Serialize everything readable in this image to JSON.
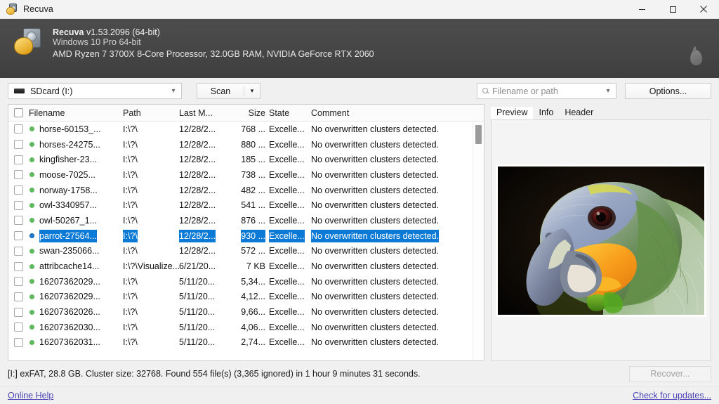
{
  "window": {
    "title": "Recuva",
    "app_icon": "recuva-icon",
    "controls": {
      "minimize": "minimize-icon",
      "maximize": "maximize-icon",
      "close": "close-icon"
    }
  },
  "info_header": {
    "app_name": "Recuva",
    "version": "v1.53.2096 (64-bit)",
    "os": "Windows 10 Pro 64-bit",
    "hardware": "AMD Ryzen 7 3700X 8-Core Processor, 32.0GB RAM, NVIDIA GeForce RTX 2060",
    "droplet_icon": "droplet-icon"
  },
  "toolbar": {
    "drive": {
      "icon": "drive-icon",
      "value": "SDcard (I:)",
      "chevron": "chevron-down-icon"
    },
    "scan_label": "Scan",
    "scan_dropdown": "chevron-down-icon",
    "filter": {
      "icon": "search-icon",
      "placeholder": "Filename or path",
      "value": "",
      "chevron": "chevron-down-icon"
    },
    "options_label": "Options..."
  },
  "list": {
    "columns": [
      "Filename",
      "Path",
      "Last M...",
      "Size",
      "State",
      "Comment"
    ],
    "select_all_checkbox": false,
    "rows": [
      {
        "checked": false,
        "state_dot": "green",
        "filename": "horse-60153_...",
        "path": "I:\\?\\",
        "modified": "12/28/2...",
        "size": "768 ...",
        "state": "Excelle...",
        "comment": "No overwritten clusters detected.",
        "selected": false
      },
      {
        "checked": false,
        "state_dot": "green",
        "filename": "horses-24275...",
        "path": "I:\\?\\",
        "modified": "12/28/2...",
        "size": "880 ...",
        "state": "Excelle...",
        "comment": "No overwritten clusters detected.",
        "selected": false
      },
      {
        "checked": false,
        "state_dot": "green",
        "filename": "kingfisher-23...",
        "path": "I:\\?\\",
        "modified": "12/28/2...",
        "size": "185 ...",
        "state": "Excelle...",
        "comment": "No overwritten clusters detected.",
        "selected": false
      },
      {
        "checked": false,
        "state_dot": "green",
        "filename": "moose-7025...",
        "path": "I:\\?\\",
        "modified": "12/28/2...",
        "size": "738 ...",
        "state": "Excelle...",
        "comment": "No overwritten clusters detected.",
        "selected": false
      },
      {
        "checked": false,
        "state_dot": "green",
        "filename": "norway-1758...",
        "path": "I:\\?\\",
        "modified": "12/28/2...",
        "size": "482 ...",
        "state": "Excelle...",
        "comment": "No overwritten clusters detected.",
        "selected": false
      },
      {
        "checked": false,
        "state_dot": "green",
        "filename": "owl-3340957...",
        "path": "I:\\?\\",
        "modified": "12/28/2...",
        "size": "541 ...",
        "state": "Excelle...",
        "comment": "No overwritten clusters detected.",
        "selected": false
      },
      {
        "checked": false,
        "state_dot": "green",
        "filename": "owl-50267_1...",
        "path": "I:\\?\\",
        "modified": "12/28/2...",
        "size": "876 ...",
        "state": "Excelle...",
        "comment": "No overwritten clusters detected.",
        "selected": false
      },
      {
        "checked": false,
        "state_dot": "blue",
        "filename": "parrot-27564...",
        "path": "I:\\?\\",
        "modified": "12/28/2...",
        "size": "930 ...",
        "state": "Excelle...",
        "comment": "No overwritten clusters detected.",
        "selected": true
      },
      {
        "checked": false,
        "state_dot": "green",
        "filename": "swan-235066...",
        "path": "I:\\?\\",
        "modified": "12/28/2...",
        "size": "572 ...",
        "state": "Excelle...",
        "comment": "No overwritten clusters detected.",
        "selected": false
      },
      {
        "checked": false,
        "state_dot": "green",
        "filename": "attribcache14...",
        "path": "I:\\?\\Visualize...",
        "modified": "6/21/20...",
        "size": "7 KB",
        "state": "Excelle...",
        "comment": "No overwritten clusters detected.",
        "selected": false
      },
      {
        "checked": false,
        "state_dot": "green",
        "filename": "16207362029...",
        "path": "I:\\?\\",
        "modified": "5/11/20...",
        "size": "5,34...",
        "state": "Excelle...",
        "comment": "No overwritten clusters detected.",
        "selected": false
      },
      {
        "checked": false,
        "state_dot": "green",
        "filename": "16207362029...",
        "path": "I:\\?\\",
        "modified": "5/11/20...",
        "size": "4,12...",
        "state": "Excelle...",
        "comment": "No overwritten clusters detected.",
        "selected": false
      },
      {
        "checked": false,
        "state_dot": "green",
        "filename": "16207362026...",
        "path": "I:\\?\\",
        "modified": "5/11/20...",
        "size": "9,66...",
        "state": "Excelle...",
        "comment": "No overwritten clusters detected.",
        "selected": false
      },
      {
        "checked": false,
        "state_dot": "green",
        "filename": "16207362030...",
        "path": "I:\\?\\",
        "modified": "5/11/20...",
        "size": "4,06...",
        "state": "Excelle...",
        "comment": "No overwritten clusters detected.",
        "selected": false
      },
      {
        "checked": false,
        "state_dot": "green",
        "filename": "16207362031...",
        "path": "I:\\?\\",
        "modified": "5/11/20...",
        "size": "2,74...",
        "state": "Excelle...",
        "comment": "No overwritten clusters detected.",
        "selected": false
      }
    ]
  },
  "preview": {
    "tabs": [
      {
        "label": "Preview",
        "active": true
      },
      {
        "label": "Info",
        "active": false
      },
      {
        "label": "Header",
        "active": false
      }
    ],
    "image_alt": "parrot-preview-image"
  },
  "status": {
    "text": "[I:] exFAT, 28.8 GB. Cluster size: 32768. Found 554 file(s) (3,365 ignored) in 1 hour 9 minutes 31 seconds.",
    "recover_label": "Recover...",
    "recover_enabled": false
  },
  "footer": {
    "online_help": "Online Help",
    "check_updates": "Check for updates..."
  },
  "colors": {
    "selection_blue": "#0b7ad6",
    "link_purple": "#4a43b4",
    "header_dark": "#464646",
    "state_dot_green": "#5eb85e"
  }
}
